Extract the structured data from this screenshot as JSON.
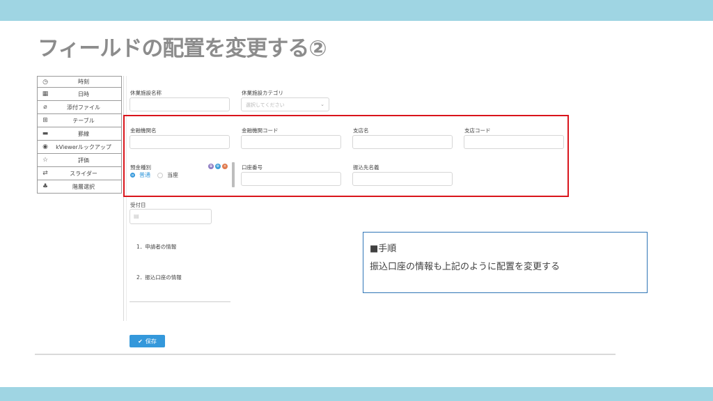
{
  "slide": {
    "title": "フィールドの配置を変更する②",
    "band_color": "#9fd5e3"
  },
  "palette": [
    {
      "icon": "clock-icon",
      "glyph": "◷",
      "label": "時刻"
    },
    {
      "icon": "calendar-clock-icon",
      "glyph": "▦",
      "label": "日時"
    },
    {
      "icon": "paperclip-icon",
      "glyph": "⌀",
      "label": "添付ファイル"
    },
    {
      "icon": "table-icon",
      "glyph": "⊞",
      "label": "テーブル"
    },
    {
      "icon": "divider-icon",
      "glyph": "▬",
      "label": "罫線"
    },
    {
      "icon": "eye-icon",
      "glyph": "◉",
      "label": "kViewerルックアップ"
    },
    {
      "icon": "star-icon",
      "glyph": "☆",
      "label": "評価"
    },
    {
      "icon": "arrows-icon",
      "glyph": "⇄",
      "label": "スライダー"
    },
    {
      "icon": "hierarchy-icon",
      "glyph": "♣",
      "label": "階層選択"
    }
  ],
  "form": {
    "facility_name_label": "休業施設名称",
    "facility_category_label": "休業施設カテゴリ",
    "facility_category_placeholder": "選択してください",
    "bank_name_label": "金融機関名",
    "bank_code_label": "金融機関コード",
    "branch_name_label": "支店名",
    "branch_code_label": "支店コード",
    "account_type_label": "預金種別",
    "account_type_selected": "普通",
    "account_type_other": "当座",
    "account_number_label": "口座番号",
    "payee_name_label": "振込先名義",
    "receipt_date_label": "受付日",
    "section1": "1．申請者の情報",
    "section2": "2．振込口座の情報",
    "save_label": "保存"
  },
  "note": {
    "heading": "■手順",
    "body": "振込口座の情報も上記のように配置を変更する"
  },
  "colors": {
    "highlight": "#d9141b",
    "accent": "#3498db",
    "note_border": "#2e75b6"
  }
}
